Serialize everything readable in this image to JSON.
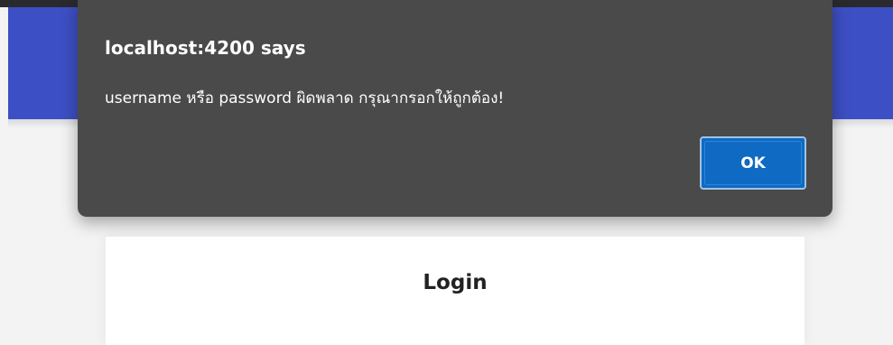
{
  "dialog": {
    "title": "localhost:4200 says",
    "message": "username หรือ password ผิดพลาด กรุณากรอกให้ถูกต้อง!",
    "ok_label": "OK"
  },
  "login": {
    "title": "Login"
  },
  "colors": {
    "header": "#3d4fc4",
    "dialog_bg": "#4a4a4a",
    "ok_button": "#0f6ac3"
  }
}
